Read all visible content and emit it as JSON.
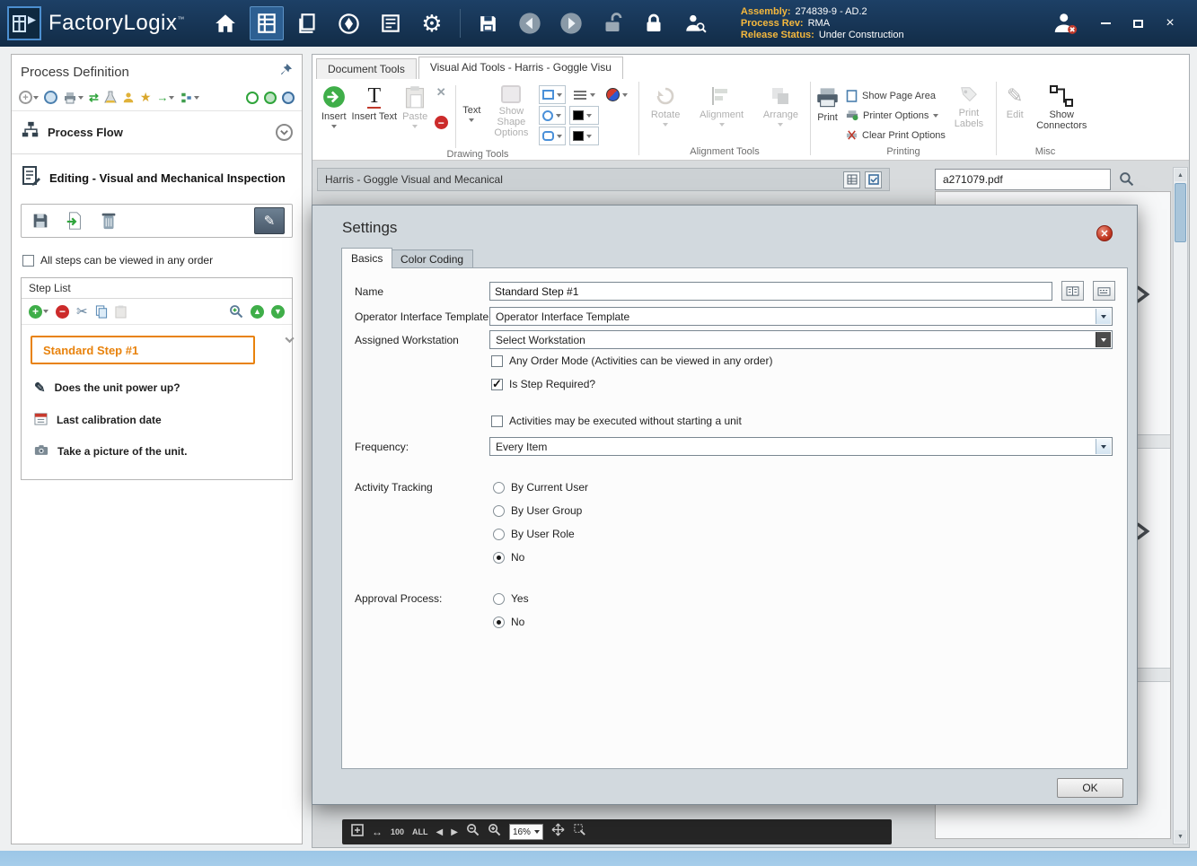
{
  "titlebar": {
    "app_name": "FactoryLogix",
    "trademark": "™",
    "assembly_label": "Assembly:",
    "assembly_value": "274839-9 - AD.2",
    "process_rev_label": "Process Rev:",
    "process_rev_value": "RMA",
    "release_status_label": "Release Status:",
    "release_status_value": "Under Construction"
  },
  "left_panel": {
    "title": "Process Definition",
    "process_flow_label": "Process Flow",
    "editing_title": "Editing - Visual and Mechanical Inspection",
    "view_order_checkbox": "All steps can be viewed in any order",
    "step_list_title": "Step List",
    "steps": [
      {
        "label": "Standard Step #1"
      },
      {
        "label": "Does the unit power up?"
      },
      {
        "label": "Last calibration date"
      },
      {
        "label": "Take a picture of the unit."
      }
    ]
  },
  "ribbon": {
    "tabs": [
      {
        "label": "Document Tools"
      },
      {
        "label": "Visual Aid Tools - Harris - Goggle Visu"
      }
    ],
    "insert_label": "Insert",
    "insert_text_label": "Insert Text",
    "paste_label": "Paste",
    "text_label": "Text",
    "show_shape_options_label": "Show Shape Options",
    "drawing_group_label": "Drawing Tools",
    "rotate_label": "Rotate",
    "alignment_label": "Alignment",
    "arrange_label": "Arrange",
    "alignment_group_label": "Alignment Tools",
    "print_label": "Print",
    "show_page_area_label": "Show Page Area",
    "printer_options_label": "Printer Options",
    "clear_print_options_label": "Clear Print Options",
    "print_labels_label": "Print Labels",
    "printing_group_label": "Printing",
    "edit_label": "Edit",
    "show_connectors_label": "Show Connectors",
    "misc_group_label": "Misc"
  },
  "document_area": {
    "doc_title": "Harris - Goggle Visual and Mecanical",
    "pdf_name": "a271079.pdf",
    "zoom_value": "16%",
    "zoom_100": "100",
    "zoom_all": "ALL"
  },
  "settings_dialog": {
    "title": "Settings",
    "tab_basics": "Basics",
    "tab_color_coding": "Color Coding",
    "name_label": "Name",
    "name_value": "Standard Step #1",
    "operator_interface_label": "Operator Interface Template",
    "operator_interface_value": "Operator Interface Template",
    "assigned_workstation_label": "Assigned Workstation",
    "assigned_workstation_value": "Select Workstation",
    "any_order_label": "Any Order Mode (Activities can be viewed in any order)",
    "is_step_required_label": "Is Step Required?",
    "activities_without_unit_label": "Activities may be executed without starting a unit",
    "frequency_label": "Frequency:",
    "frequency_value": "Every Item",
    "activity_tracking_label": "Activity Tracking",
    "activity_options": [
      "By Current User",
      "By User Group",
      "By User Role",
      "No"
    ],
    "approval_label": "Approval Process:",
    "approval_options": [
      "Yes",
      "No"
    ],
    "ok_label": "OK"
  }
}
